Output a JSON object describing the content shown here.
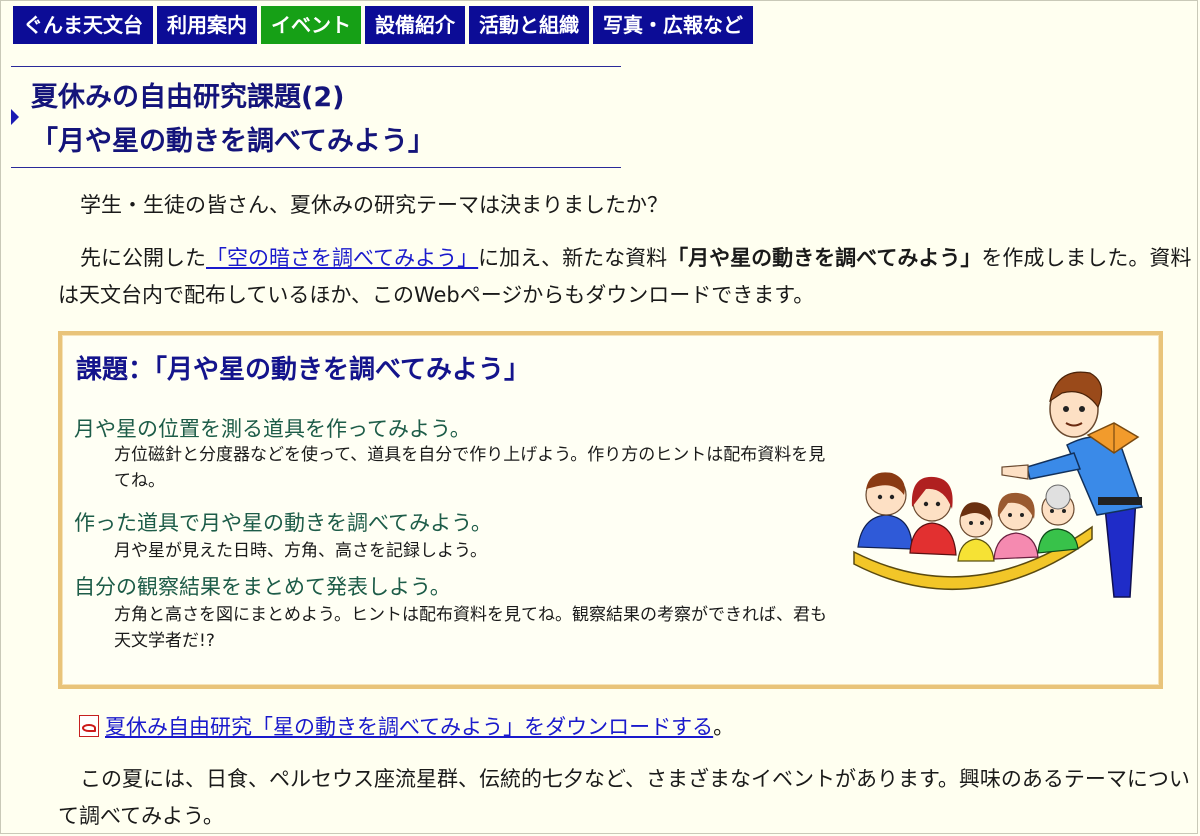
{
  "nav": {
    "items": [
      {
        "label": "ぐんま天文台"
      },
      {
        "label": "利用案内"
      },
      {
        "label": "イベント"
      },
      {
        "label": "設備紹介"
      },
      {
        "label": "活動と組織"
      },
      {
        "label": "写真・広報など"
      }
    ],
    "active_index": 2
  },
  "heading": {
    "line1": "夏休みの自由研究課題(2)",
    "line2": "「月や星の動きを調べてみよう」"
  },
  "intro": {
    "para1": "学生・生徒の皆さん、夏休みの研究テーマは決まりましたか？",
    "para2_before_link": "先に公開した",
    "para2_link": "「空の暗さを調べてみよう」",
    "para2_middle": "に加え、新たな資料",
    "para2_bold": "「月や星の動きを調べてみよう」",
    "para2_after": "を作成しました。資料は天文台内で配布しているほか、このWebページからもダウンロードできます。"
  },
  "task_box": {
    "title": "課題：「月や星の動きを調べてみよう」",
    "items": [
      {
        "head": "月や星の位置を測る道具を作ってみよう。",
        "desc": "方位磁針と分度器などを使って、道具を自分で作り上げよう。作り方のヒントは配布資料を見てね。"
      },
      {
        "head": "作った道具で月や星の動きを調べてみよう。",
        "desc": "月や星が見えた日時、方角、高さを記録しよう。"
      },
      {
        "head": "自分の観察結果をまとめて発表しよう。",
        "desc": "方角と高さを図にまとめよう。ヒントは配布資料を見てね。観察結果の考察ができれば、君も天文学者だ!?"
      }
    ]
  },
  "download": {
    "link_text": "夏休み自由研究「星の動きを調べてみよう」をダウンロードする",
    "suffix": "。",
    "icon": "pdf-icon"
  },
  "outro": {
    "para3": "この夏には、日食、ペルセウス座流星群、伝統的七夕など、さまざまなイベントがあります。興味のあるテーマについて調べてみよう。"
  },
  "colors": {
    "nav_bg": "#0c0c96",
    "nav_active_bg": "#16a016",
    "heading_text": "#14147a",
    "link": "#1a1acc",
    "box_border": "#e9c47a",
    "page_bg": "#fffff0"
  }
}
